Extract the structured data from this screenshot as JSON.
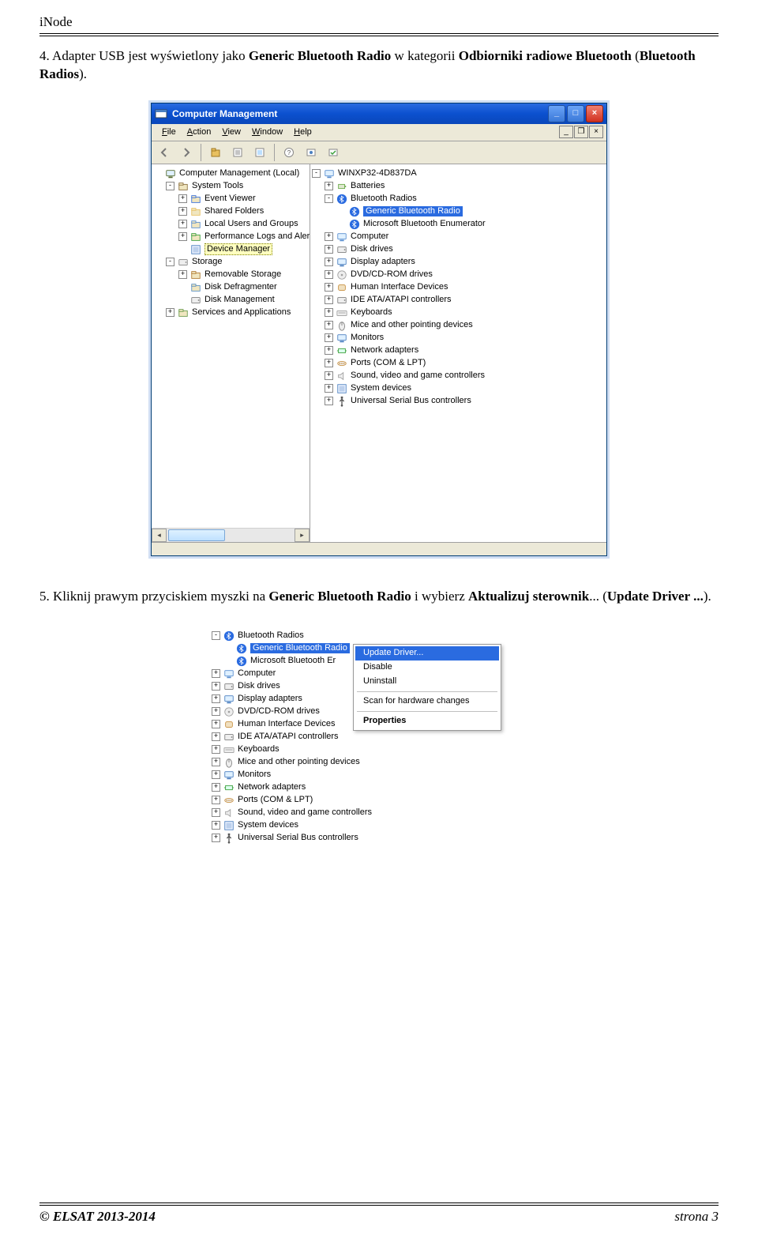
{
  "header": {
    "doc_title": "iNode"
  },
  "para1": {
    "prefix": "4. Adapter USB jest wyświetlony jako ",
    "bold1": "Generic Bluetooth Radio",
    "mid": " w kategorii ",
    "bold2": "Odbiorniki radiowe Bluetooth",
    "suffix1": " (",
    "bold3": "Bluetooth Radios",
    "suffix2": ")."
  },
  "cm": {
    "title": "Computer Management",
    "menubar": [
      "File",
      "Action",
      "View",
      "Window",
      "Help"
    ],
    "left_tree": [
      {
        "indent": 0,
        "exp": "",
        "icon": "monitor",
        "label": "Computer Management (Local)"
      },
      {
        "indent": 1,
        "exp": "-",
        "icon": "tools",
        "label": "System Tools"
      },
      {
        "indent": 2,
        "exp": "+",
        "icon": "book",
        "label": "Event Viewer"
      },
      {
        "indent": 2,
        "exp": "+",
        "icon": "folder",
        "label": "Shared Folders"
      },
      {
        "indent": 2,
        "exp": "+",
        "icon": "users",
        "label": "Local Users and Groups"
      },
      {
        "indent": 2,
        "exp": "+",
        "icon": "chart",
        "label": "Performance Logs and Alerts"
      },
      {
        "indent": 2,
        "exp": "",
        "icon": "device",
        "label": "Device Manager",
        "selected": true
      },
      {
        "indent": 1,
        "exp": "-",
        "icon": "storage",
        "label": "Storage"
      },
      {
        "indent": 2,
        "exp": "+",
        "icon": "removable",
        "label": "Removable Storage"
      },
      {
        "indent": 2,
        "exp": "",
        "icon": "defrag",
        "label": "Disk Defragmenter"
      },
      {
        "indent": 2,
        "exp": "",
        "icon": "diskmgmt",
        "label": "Disk Management"
      },
      {
        "indent": 1,
        "exp": "+",
        "icon": "services",
        "label": "Services and Applications"
      }
    ],
    "right_tree": [
      {
        "indent": 0,
        "exp": "-",
        "icon": "computer",
        "label": "WINXP32-4D837DA"
      },
      {
        "indent": 1,
        "exp": "+",
        "icon": "battery",
        "label": "Batteries"
      },
      {
        "indent": 1,
        "exp": "-",
        "icon": "bt",
        "label": "Bluetooth Radios"
      },
      {
        "indent": 2,
        "exp": "",
        "icon": "bt",
        "label": "Generic Bluetooth Radio",
        "hl": true
      },
      {
        "indent": 2,
        "exp": "",
        "icon": "bt",
        "label": "Microsoft Bluetooth Enumerator"
      },
      {
        "indent": 1,
        "exp": "+",
        "icon": "computer",
        "label": "Computer"
      },
      {
        "indent": 1,
        "exp": "+",
        "icon": "disk",
        "label": "Disk drives"
      },
      {
        "indent": 1,
        "exp": "+",
        "icon": "display",
        "label": "Display adapters"
      },
      {
        "indent": 1,
        "exp": "+",
        "icon": "dvd",
        "label": "DVD/CD-ROM drives"
      },
      {
        "indent": 1,
        "exp": "+",
        "icon": "hid",
        "label": "Human Interface Devices"
      },
      {
        "indent": 1,
        "exp": "+",
        "icon": "ide",
        "label": "IDE ATA/ATAPI controllers"
      },
      {
        "indent": 1,
        "exp": "+",
        "icon": "keyboard",
        "label": "Keyboards"
      },
      {
        "indent": 1,
        "exp": "+",
        "icon": "mouse",
        "label": "Mice and other pointing devices"
      },
      {
        "indent": 1,
        "exp": "+",
        "icon": "monitor2",
        "label": "Monitors"
      },
      {
        "indent": 1,
        "exp": "+",
        "icon": "net",
        "label": "Network adapters"
      },
      {
        "indent": 1,
        "exp": "+",
        "icon": "port",
        "label": "Ports (COM & LPT)"
      },
      {
        "indent": 1,
        "exp": "+",
        "icon": "sound",
        "label": "Sound, video and game controllers"
      },
      {
        "indent": 1,
        "exp": "+",
        "icon": "system",
        "label": "System devices"
      },
      {
        "indent": 1,
        "exp": "+",
        "icon": "usb",
        "label": "Universal Serial Bus controllers"
      }
    ]
  },
  "para2": {
    "prefix": "5. Kliknij prawym przyciskiem myszki na ",
    "bold1": "Generic Bluetooth Radio",
    "mid": " i wybierz ",
    "bold2": "Aktualizuj sterownik",
    "dots1": "...",
    "open": " (",
    "bold3": "Update Driver ...",
    "close": ")."
  },
  "ctx": {
    "tree": [
      {
        "indent": 0,
        "exp": "-",
        "icon": "bt",
        "label": "Bluetooth Radios"
      },
      {
        "indent": 1,
        "exp": "",
        "icon": "bt",
        "label": "Generic Bluetooth Radio",
        "hl": true,
        "cut": true
      },
      {
        "indent": 1,
        "exp": "",
        "icon": "bt",
        "label": "Microsoft Bluetooth Er",
        "cut": true
      },
      {
        "indent": 0,
        "exp": "+",
        "icon": "computer",
        "label": "Computer"
      },
      {
        "indent": 0,
        "exp": "+",
        "icon": "disk",
        "label": "Disk drives"
      },
      {
        "indent": 0,
        "exp": "+",
        "icon": "display",
        "label": "Display adapters"
      },
      {
        "indent": 0,
        "exp": "+",
        "icon": "dvd",
        "label": "DVD/CD-ROM drives"
      },
      {
        "indent": 0,
        "exp": "+",
        "icon": "hid",
        "label": "Human Interface Devices"
      },
      {
        "indent": 0,
        "exp": "+",
        "icon": "ide",
        "label": "IDE ATA/ATAPI controllers"
      },
      {
        "indent": 0,
        "exp": "+",
        "icon": "keyboard",
        "label": "Keyboards"
      },
      {
        "indent": 0,
        "exp": "+",
        "icon": "mouse",
        "label": "Mice and other pointing devices"
      },
      {
        "indent": 0,
        "exp": "+",
        "icon": "monitor2",
        "label": "Monitors"
      },
      {
        "indent": 0,
        "exp": "+",
        "icon": "net",
        "label": "Network adapters"
      },
      {
        "indent": 0,
        "exp": "+",
        "icon": "port",
        "label": "Ports (COM & LPT)"
      },
      {
        "indent": 0,
        "exp": "+",
        "icon": "sound",
        "label": "Sound, video and game controllers"
      },
      {
        "indent": 0,
        "exp": "+",
        "icon": "system",
        "label": "System devices"
      },
      {
        "indent": 0,
        "exp": "+",
        "icon": "usb",
        "label": "Universal Serial Bus controllers"
      }
    ],
    "menu": [
      {
        "label": "Update Driver...",
        "sel": true
      },
      {
        "label": "Disable"
      },
      {
        "label": "Uninstall"
      },
      {
        "sep": true
      },
      {
        "label": "Scan for hardware changes"
      },
      {
        "sep": true
      },
      {
        "label": "Properties",
        "bold": true
      }
    ]
  },
  "footer": {
    "left": "© ELSAT 2013-2014",
    "right": "strona 3"
  },
  "icons": {
    "monitor": "#556b2f",
    "tools": "#8b6f3e",
    "book": "#3a6fd8",
    "folder": "#e8c060",
    "users": "#5a8fd0",
    "chart": "#3a9f3a",
    "device": "#4a7fc0",
    "storage": "#888",
    "removable": "#b07a30",
    "defrag": "#5a8fc0",
    "diskmgmt": "#808080",
    "services": "#6a9a4a",
    "computer": "#5a8fd0",
    "battery": "#6aaa4a",
    "bt": "#2a6be0",
    "disk": "#808080",
    "display": "#4a7fc0",
    "dvd": "#a0a0a0",
    "hid": "#c89040",
    "ide": "#808080",
    "keyboard": "#a0a0a0",
    "mouse": "#808080",
    "monitor2": "#4a7fc0",
    "net": "#3a9f3a",
    "port": "#c89040",
    "sound": "#a0a0a0",
    "system": "#4a7fc0",
    "usb": "#555"
  }
}
